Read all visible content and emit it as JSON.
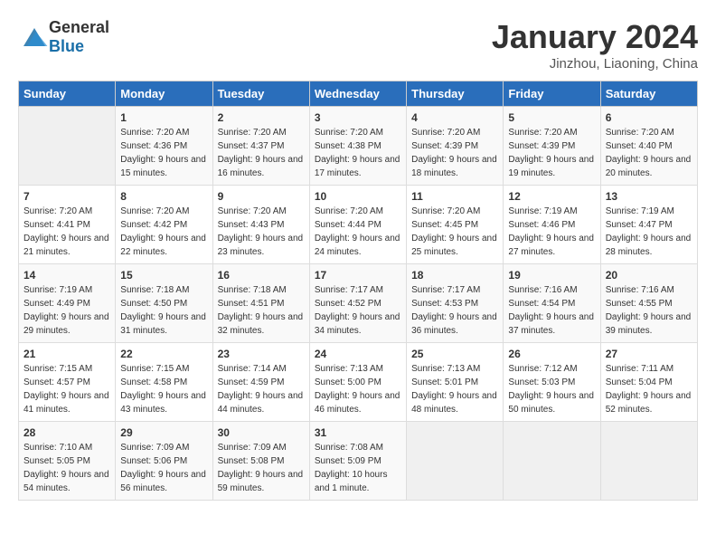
{
  "header": {
    "logo_general": "General",
    "logo_blue": "Blue",
    "month_title": "January 2024",
    "location": "Jinzhou, Liaoning, China"
  },
  "weekdays": [
    "Sunday",
    "Monday",
    "Tuesday",
    "Wednesday",
    "Thursday",
    "Friday",
    "Saturday"
  ],
  "weeks": [
    [
      {
        "day": "",
        "sunrise": "",
        "sunset": "",
        "daylight": ""
      },
      {
        "day": "1",
        "sunrise": "Sunrise: 7:20 AM",
        "sunset": "Sunset: 4:36 PM",
        "daylight": "Daylight: 9 hours and 15 minutes."
      },
      {
        "day": "2",
        "sunrise": "Sunrise: 7:20 AM",
        "sunset": "Sunset: 4:37 PM",
        "daylight": "Daylight: 9 hours and 16 minutes."
      },
      {
        "day": "3",
        "sunrise": "Sunrise: 7:20 AM",
        "sunset": "Sunset: 4:38 PM",
        "daylight": "Daylight: 9 hours and 17 minutes."
      },
      {
        "day": "4",
        "sunrise": "Sunrise: 7:20 AM",
        "sunset": "Sunset: 4:39 PM",
        "daylight": "Daylight: 9 hours and 18 minutes."
      },
      {
        "day": "5",
        "sunrise": "Sunrise: 7:20 AM",
        "sunset": "Sunset: 4:39 PM",
        "daylight": "Daylight: 9 hours and 19 minutes."
      },
      {
        "day": "6",
        "sunrise": "Sunrise: 7:20 AM",
        "sunset": "Sunset: 4:40 PM",
        "daylight": "Daylight: 9 hours and 20 minutes."
      }
    ],
    [
      {
        "day": "7",
        "sunrise": "Sunrise: 7:20 AM",
        "sunset": "Sunset: 4:41 PM",
        "daylight": "Daylight: 9 hours and 21 minutes."
      },
      {
        "day": "8",
        "sunrise": "Sunrise: 7:20 AM",
        "sunset": "Sunset: 4:42 PM",
        "daylight": "Daylight: 9 hours and 22 minutes."
      },
      {
        "day": "9",
        "sunrise": "Sunrise: 7:20 AM",
        "sunset": "Sunset: 4:43 PM",
        "daylight": "Daylight: 9 hours and 23 minutes."
      },
      {
        "day": "10",
        "sunrise": "Sunrise: 7:20 AM",
        "sunset": "Sunset: 4:44 PM",
        "daylight": "Daylight: 9 hours and 24 minutes."
      },
      {
        "day": "11",
        "sunrise": "Sunrise: 7:20 AM",
        "sunset": "Sunset: 4:45 PM",
        "daylight": "Daylight: 9 hours and 25 minutes."
      },
      {
        "day": "12",
        "sunrise": "Sunrise: 7:19 AM",
        "sunset": "Sunset: 4:46 PM",
        "daylight": "Daylight: 9 hours and 27 minutes."
      },
      {
        "day": "13",
        "sunrise": "Sunrise: 7:19 AM",
        "sunset": "Sunset: 4:47 PM",
        "daylight": "Daylight: 9 hours and 28 minutes."
      }
    ],
    [
      {
        "day": "14",
        "sunrise": "Sunrise: 7:19 AM",
        "sunset": "Sunset: 4:49 PM",
        "daylight": "Daylight: 9 hours and 29 minutes."
      },
      {
        "day": "15",
        "sunrise": "Sunrise: 7:18 AM",
        "sunset": "Sunset: 4:50 PM",
        "daylight": "Daylight: 9 hours and 31 minutes."
      },
      {
        "day": "16",
        "sunrise": "Sunrise: 7:18 AM",
        "sunset": "Sunset: 4:51 PM",
        "daylight": "Daylight: 9 hours and 32 minutes."
      },
      {
        "day": "17",
        "sunrise": "Sunrise: 7:17 AM",
        "sunset": "Sunset: 4:52 PM",
        "daylight": "Daylight: 9 hours and 34 minutes."
      },
      {
        "day": "18",
        "sunrise": "Sunrise: 7:17 AM",
        "sunset": "Sunset: 4:53 PM",
        "daylight": "Daylight: 9 hours and 36 minutes."
      },
      {
        "day": "19",
        "sunrise": "Sunrise: 7:16 AM",
        "sunset": "Sunset: 4:54 PM",
        "daylight": "Daylight: 9 hours and 37 minutes."
      },
      {
        "day": "20",
        "sunrise": "Sunrise: 7:16 AM",
        "sunset": "Sunset: 4:55 PM",
        "daylight": "Daylight: 9 hours and 39 minutes."
      }
    ],
    [
      {
        "day": "21",
        "sunrise": "Sunrise: 7:15 AM",
        "sunset": "Sunset: 4:57 PM",
        "daylight": "Daylight: 9 hours and 41 minutes."
      },
      {
        "day": "22",
        "sunrise": "Sunrise: 7:15 AM",
        "sunset": "Sunset: 4:58 PM",
        "daylight": "Daylight: 9 hours and 43 minutes."
      },
      {
        "day": "23",
        "sunrise": "Sunrise: 7:14 AM",
        "sunset": "Sunset: 4:59 PM",
        "daylight": "Daylight: 9 hours and 44 minutes."
      },
      {
        "day": "24",
        "sunrise": "Sunrise: 7:13 AM",
        "sunset": "Sunset: 5:00 PM",
        "daylight": "Daylight: 9 hours and 46 minutes."
      },
      {
        "day": "25",
        "sunrise": "Sunrise: 7:13 AM",
        "sunset": "Sunset: 5:01 PM",
        "daylight": "Daylight: 9 hours and 48 minutes."
      },
      {
        "day": "26",
        "sunrise": "Sunrise: 7:12 AM",
        "sunset": "Sunset: 5:03 PM",
        "daylight": "Daylight: 9 hours and 50 minutes."
      },
      {
        "day": "27",
        "sunrise": "Sunrise: 7:11 AM",
        "sunset": "Sunset: 5:04 PM",
        "daylight": "Daylight: 9 hours and 52 minutes."
      }
    ],
    [
      {
        "day": "28",
        "sunrise": "Sunrise: 7:10 AM",
        "sunset": "Sunset: 5:05 PM",
        "daylight": "Daylight: 9 hours and 54 minutes."
      },
      {
        "day": "29",
        "sunrise": "Sunrise: 7:09 AM",
        "sunset": "Sunset: 5:06 PM",
        "daylight": "Daylight: 9 hours and 56 minutes."
      },
      {
        "day": "30",
        "sunrise": "Sunrise: 7:09 AM",
        "sunset": "Sunset: 5:08 PM",
        "daylight": "Daylight: 9 hours and 59 minutes."
      },
      {
        "day": "31",
        "sunrise": "Sunrise: 7:08 AM",
        "sunset": "Sunset: 5:09 PM",
        "daylight": "Daylight: 10 hours and 1 minute."
      },
      {
        "day": "",
        "sunrise": "",
        "sunset": "",
        "daylight": ""
      },
      {
        "day": "",
        "sunrise": "",
        "sunset": "",
        "daylight": ""
      },
      {
        "day": "",
        "sunrise": "",
        "sunset": "",
        "daylight": ""
      }
    ]
  ]
}
